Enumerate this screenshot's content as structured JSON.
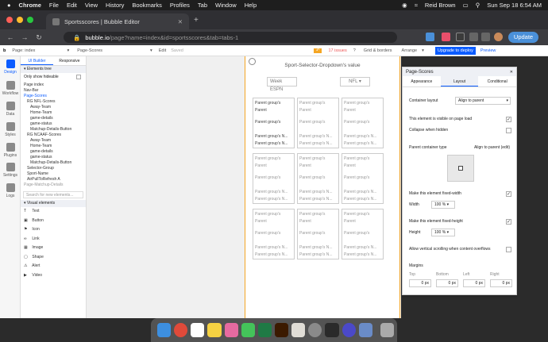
{
  "menubar": {
    "app": "Chrome",
    "items": [
      "File",
      "Edit",
      "View",
      "History",
      "Bookmarks",
      "Profiles",
      "Tab",
      "Window",
      "Help"
    ],
    "user": "Reid Brown",
    "datetime": "Sun Sep 18  6:54 AM"
  },
  "browser": {
    "tab_title": "Sportsscores | Bubble Editor",
    "url_host": "bubble.io",
    "url_path": "/page?name=index&id=sportsscores&tab=tabs-1",
    "update_label": "Update"
  },
  "toolbar": {
    "page_label": "Page: index",
    "element": "Page-Scores",
    "edit": "Edit",
    "saved": "Saved",
    "issues": "17 issues",
    "grid": "Grid & borders",
    "arrange": "Arrange",
    "deploy": "Upgrade to deploy",
    "preview": "Preview"
  },
  "sidebar": {
    "items": [
      "Design",
      "Workflow",
      "Data",
      "Styles",
      "Plugins",
      "Settings",
      "Logs"
    ]
  },
  "elements_panel": {
    "tabs": [
      "UI Builder",
      "Responsive"
    ],
    "tree_header": "Elements tree",
    "show_hideable": "Only show hideable",
    "tree": [
      "Page index",
      "Nav-Bar",
      "Page-Scores",
      "RG NFL-Scores",
      "Away-Team",
      "Home-Team",
      "game-details",
      "game-status",
      "Matchup-Details-Button",
      "RG NCAAF-Scores",
      "Away-Team",
      "Home-Team",
      "game-details",
      "game-status",
      "Matchup-Details-Button",
      "Selector-Group",
      "Sport-Name",
      "AirPullToRefresh A",
      "Page-Matchup-Details"
    ],
    "search_placeholder": "Search for new elements...",
    "visual_header": "Visual elements",
    "visual": [
      "Text",
      "Button",
      "Icon",
      "Link",
      "Image",
      "Shape",
      "Alert",
      "Video"
    ]
  },
  "canvas": {
    "title": "Sport-Selector-Dropdown's value",
    "dropdown_left": "Week ESPN",
    "dropdown_right": "NFL",
    "cell_text": "Parent group's",
    "cell_short": "Parent",
    "cell_footer": "Parent group's N..."
  },
  "property_panel": {
    "title": "Page-Scores",
    "tabs": [
      "Appearance",
      "Layout",
      "Conditional"
    ],
    "container_layout_label": "Container layout",
    "container_layout_value": "Align to parent",
    "visible_on_load": "This element is visible on page load",
    "collapse_hidden": "Collapse when hidden",
    "parent_type_label": "Parent container type",
    "parent_type_value": "Align to parent (edit)",
    "fixed_width": "Make this element fixed-width",
    "width_label": "Width",
    "width_value": "100",
    "width_unit": "%",
    "fixed_height": "Make this element fixed-height",
    "height_label": "Height",
    "height_value": "100",
    "height_unit": "%",
    "vertical_scroll": "Allow vertical scrolling when content overflows",
    "margins_label": "Margins",
    "margin_labels": [
      "Top",
      "Bottom",
      "Left",
      "Right"
    ],
    "margin_value": "0",
    "margin_unit": "px"
  }
}
